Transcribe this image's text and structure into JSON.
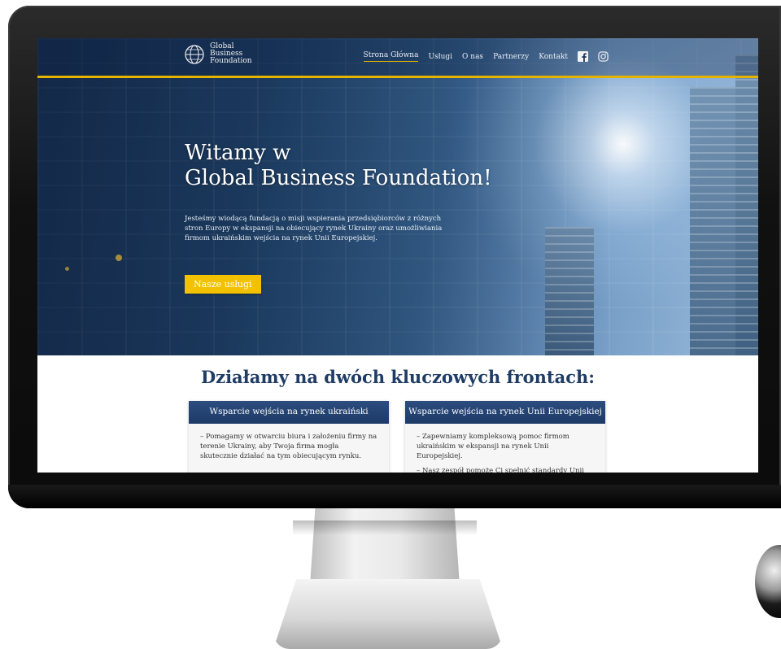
{
  "nav": {
    "logo_lines": [
      "Global",
      "Business",
      "Foundation"
    ],
    "items": [
      {
        "label": "Strona Główna",
        "active": true
      },
      {
        "label": "Usługi",
        "active": false
      },
      {
        "label": "O nas",
        "active": false
      },
      {
        "label": "Partnerzy",
        "active": false
      },
      {
        "label": "Kontakt",
        "active": false
      }
    ],
    "social": [
      "facebook-icon",
      "instagram-icon"
    ]
  },
  "hero": {
    "title_line1": "Witamy w",
    "title_line2": "Global Business Foundation!",
    "description": "Jesteśmy wiodącą fundacją o misji wspierania przedsiębiorców z różnych stron Europy w ekspansji na obiecujący rynek Ukrainy oraz umożliwiania firmom ukraińskim wejścia na rynek Unii Europejskiej.",
    "button_label": "Nasze usługi"
  },
  "section": {
    "title": "Działamy na dwóch kluczowych frontach:"
  },
  "cards": [
    {
      "heading": "Wsparcie wejścia na rynek ukraiński",
      "paragraphs": [
        "– Pomagamy w otwarciu biura i założeniu firmy na terenie Ukrainy, aby Twoja firma mogła skutecznie działać na tym obiecującym rynku."
      ]
    },
    {
      "heading": "Wsparcie wejścia na rynek Unii Europejskiej",
      "paragraphs": [
        "– Zapewniamy kompleksową pomoc firmom ukraińskim w ekspansji na rynek Unii Europejskiej.",
        "– Nasz zespół pomoże Ci spełnić standardy Unii"
      ]
    }
  ],
  "colors": {
    "accent": "#e4b400",
    "button": "#f2c200",
    "heading": "#1f3c64",
    "card_head": "#1d3a66"
  }
}
